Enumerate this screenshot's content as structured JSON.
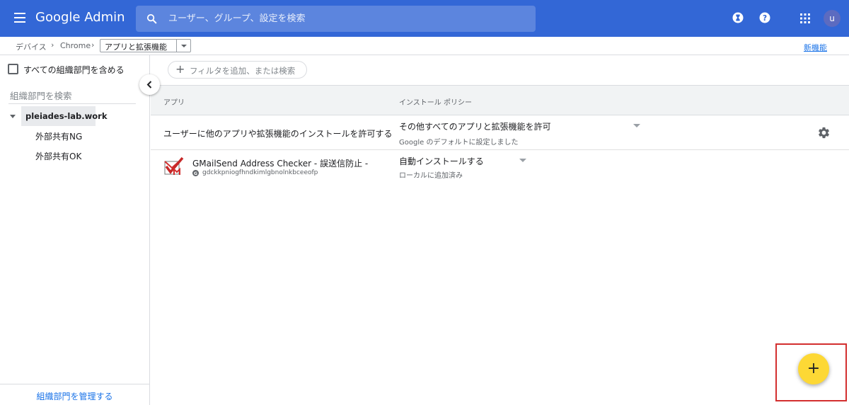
{
  "header": {
    "brand": "Google Admin",
    "search_placeholder": "ユーザー、グループ、設定を検索",
    "avatar_initial": "u"
  },
  "breadcrumb": {
    "items": [
      "デバイス",
      "Chrome"
    ],
    "current": "アプリと拡張機能",
    "new_feature_link": "新機能"
  },
  "sidebar": {
    "include_all_label": "すべての組織部門を含める",
    "search_placeholder": "組織部門を検索",
    "tree": {
      "root": "pleiades-lab.work",
      "children": [
        "外部共有NG",
        "外部共有OK"
      ]
    },
    "manage_link": "組織部門を管理する"
  },
  "main": {
    "filter_label": "フィルタを追加、または検索",
    "columns": [
      "アプリ",
      "インストール ポリシー"
    ],
    "rows": [
      {
        "app": "ユーザーに他のアプリや拡張機能のインストールを許可する",
        "policy": "その他すべてのアプリと拡張機能を許可",
        "policy_note": "Google のデフォルトに設定しました"
      },
      {
        "app": "GMailSend Address Checker - 誤送信防止 -",
        "app_id": "gdckkpniogfhndkimlgbnolnkbceeofp",
        "policy": "自動インストールする",
        "policy_note": "ローカルに追加済み"
      }
    ],
    "fab_symbol": "+"
  },
  "colors": {
    "header_bg": "#3367d6",
    "search_bg": "#5c85de",
    "link": "#1a73e8",
    "fab": "#fdd835",
    "highlight_box": "#d32f2f"
  },
  "icons": [
    "menu-icon",
    "search-icon",
    "hourglass-icon",
    "help-icon",
    "apps-grid-icon",
    "chevron-left-icon",
    "gear-icon",
    "gmail-checker-icon",
    "google-g-icon",
    "plus-icon"
  ]
}
